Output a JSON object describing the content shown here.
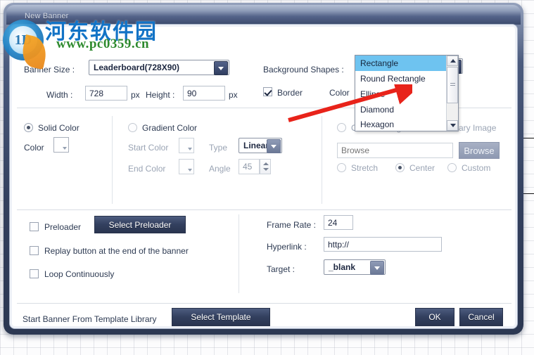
{
  "window": {
    "title": "New Banner"
  },
  "watermark": {
    "logo_text": "1D",
    "site_cn": "河东软件园",
    "site_url": "www.pc0359.cn"
  },
  "top_section": {
    "banner_size_label": "Banner Size :",
    "banner_size_value": "Leaderboard(728X90)",
    "width_label": "Width :",
    "width_value": "728",
    "width_unit": "px",
    "height_label": "Height :",
    "height_value": "90",
    "height_unit": "px",
    "background_shapes_label": "Background Shapes :",
    "background_shapes_value": "Rectangle",
    "border_label": "Border",
    "border_checked": true,
    "color_label": "Color"
  },
  "shape_dropdown": {
    "open": true,
    "selected": "Rectangle",
    "options": [
      "Rectangle",
      "Round Rectangle",
      "Ellipse",
      "Diamond",
      "Hexagon"
    ]
  },
  "fill_section": {
    "solid_color_label": "Solid Color",
    "solid_color_selected": true,
    "color_label": "Color",
    "gradient_color_label": "Gradient Color",
    "gradient_color_selected": false,
    "start_color_label": "Start Color",
    "end_color_label": "End Color",
    "type_label": "Type",
    "type_value": "Linear",
    "angle_label": "Angle",
    "angle_value": "45"
  },
  "image_section": {
    "custom_image_label": "Custom Image",
    "custom_image_selected": false,
    "library_image_label": "Library Image",
    "browse_placeholder": "Browse",
    "browse_button_label": "Browse",
    "stretch_label": "Stretch",
    "center_label": "Center",
    "custom_label": "Custom",
    "fit_selected": "Center"
  },
  "options_section": {
    "preloader_label": "Preloader",
    "preloader_checked": false,
    "select_preloader_button": "Select Preloader",
    "replay_label": "Replay button at the end of the banner",
    "replay_checked": false,
    "loop_label": "Loop Continuously",
    "loop_checked": false,
    "frame_rate_label": "Frame Rate :",
    "frame_rate_value": "24",
    "hyperlink_label": "Hyperlink :",
    "hyperlink_value": "http://",
    "target_label": "Target :",
    "target_value": "_blank"
  },
  "footer": {
    "template_library_label": "Start Banner From Template Library",
    "select_template_button": "Select Template",
    "ok_button": "OK",
    "cancel_button": "Cancel"
  },
  "colors": {
    "title_bar_dark": "#3b4a6c",
    "dialog_border": "#2c3852",
    "highlight_blue": "#6ec3f0",
    "accent_red": "#e8231a",
    "watermark_blue": "#1273c6",
    "watermark_green": "#2e8a2e"
  }
}
